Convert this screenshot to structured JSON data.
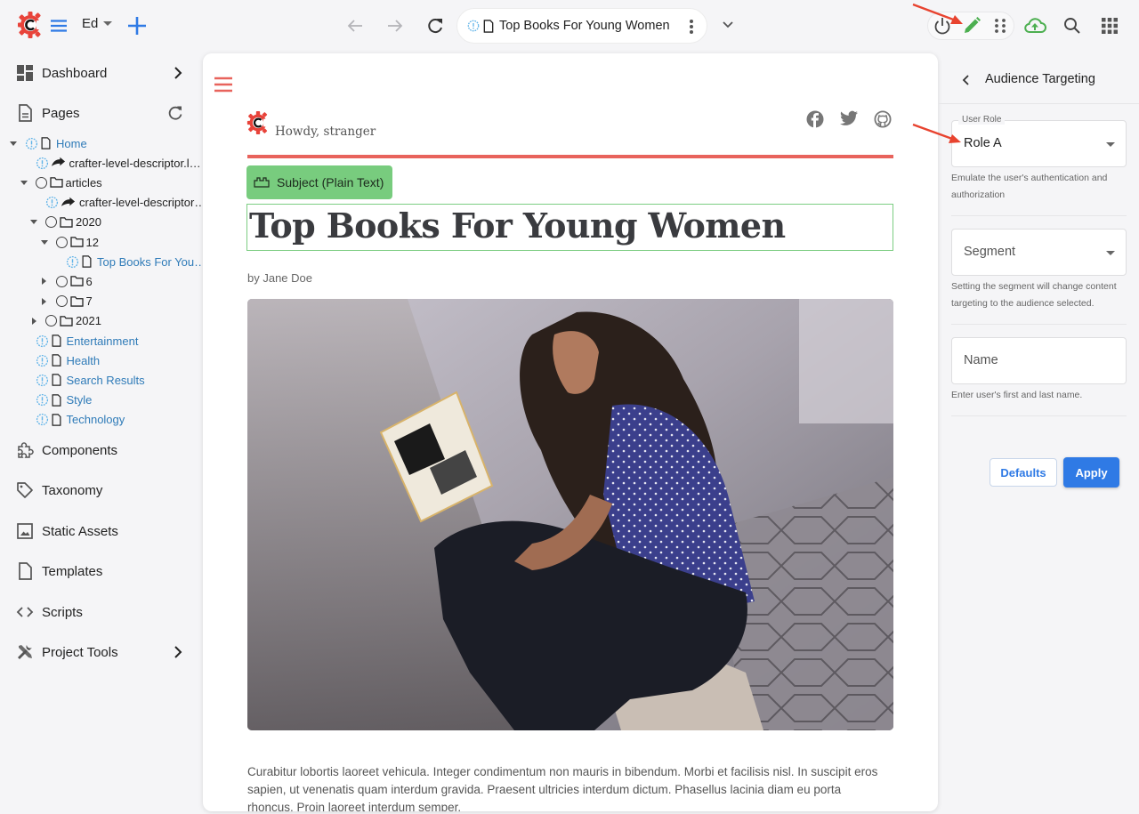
{
  "topbar": {
    "user_label": "Ed",
    "address": {
      "page_title": "Top Books For Young Women"
    }
  },
  "sidebar": {
    "dashboard": "Dashboard",
    "pages": "Pages",
    "tree": [
      {
        "label": "Home",
        "style": "link",
        "indent": 0,
        "toggle": "down",
        "marker": "badge",
        "icon": "page"
      },
      {
        "label": "crafter-level-descriptor.l…",
        "style": "plain",
        "indent": 1,
        "toggle": "none",
        "marker": "badge",
        "icon": "redirect"
      },
      {
        "label": "articles",
        "style": "plain",
        "indent": 1,
        "toggle": "down",
        "marker": "circle",
        "icon": "folder"
      },
      {
        "label": "crafter-level-descriptor…",
        "style": "plain",
        "indent": 2,
        "toggle": "none",
        "marker": "badge",
        "icon": "redirect"
      },
      {
        "label": "2020",
        "style": "plain",
        "indent": 2,
        "toggle": "down",
        "marker": "circle",
        "icon": "folder"
      },
      {
        "label": "12",
        "style": "plain",
        "indent": 3,
        "toggle": "down",
        "marker": "circle",
        "icon": "folder"
      },
      {
        "label": "Top Books For You…",
        "style": "link",
        "indent": 4,
        "toggle": "none",
        "marker": "badge",
        "icon": "page"
      },
      {
        "label": "6",
        "style": "plain",
        "indent": 3,
        "toggle": "right",
        "marker": "circle",
        "icon": "folder"
      },
      {
        "label": "7",
        "style": "plain",
        "indent": 3,
        "toggle": "right",
        "marker": "circle",
        "icon": "folder"
      },
      {
        "label": "2021",
        "style": "plain",
        "indent": 2,
        "toggle": "right",
        "marker": "circle",
        "icon": "folder"
      },
      {
        "label": "Entertainment",
        "style": "link",
        "indent": 1,
        "toggle": "none",
        "marker": "badge",
        "icon": "page"
      },
      {
        "label": "Health",
        "style": "link",
        "indent": 1,
        "toggle": "none",
        "marker": "badge",
        "icon": "page"
      },
      {
        "label": "Search Results",
        "style": "link",
        "indent": 1,
        "toggle": "none",
        "marker": "badge",
        "icon": "page"
      },
      {
        "label": "Style",
        "style": "link",
        "indent": 1,
        "toggle": "none",
        "marker": "badge",
        "icon": "page"
      },
      {
        "label": "Technology",
        "style": "link",
        "indent": 1,
        "toggle": "none",
        "marker": "badge",
        "icon": "page"
      }
    ],
    "components": "Components",
    "taxonomy": "Taxonomy",
    "static_assets": "Static Assets",
    "templates": "Templates",
    "scripts": "Scripts",
    "project_tools": "Project Tools"
  },
  "preview": {
    "greeting": "Howdy, stranger",
    "field_tag": "Subject (Plain Text)",
    "headline": "Top Books For Young Women",
    "byline": "by Jane Doe",
    "hero_alt": "Woman reading a book while sitting on a curb",
    "body": "Curabitur lobortis laoreet vehicula. Integer condimentum non mauris in bibendum. Morbi et facilisis nisl. In suscipit eros sapien, ut venenatis quam interdum gravida. Praesent ultricies interdum dictum. Phasellus lacinia diam eu porta rhoncus. Proin laoreet interdum semper."
  },
  "panel": {
    "title": "Audience Targeting",
    "user_role": {
      "legend": "User Role",
      "value": "Role A",
      "help": "Emulate the user's authentication and authorization"
    },
    "segment": {
      "placeholder": "Segment",
      "help": "Setting the segment will change content targeting to the audience selected."
    },
    "name": {
      "placeholder": "Name",
      "help": "Enter user's first and last name."
    },
    "defaults_label": "Defaults",
    "apply_label": "Apply"
  },
  "colors": {
    "brand_red": "#e8433a",
    "accent_blue": "#2f7ae5",
    "edit_green": "#4caf50",
    "field_green": "#78cc7e",
    "link_blue": "#2f7bb8"
  }
}
